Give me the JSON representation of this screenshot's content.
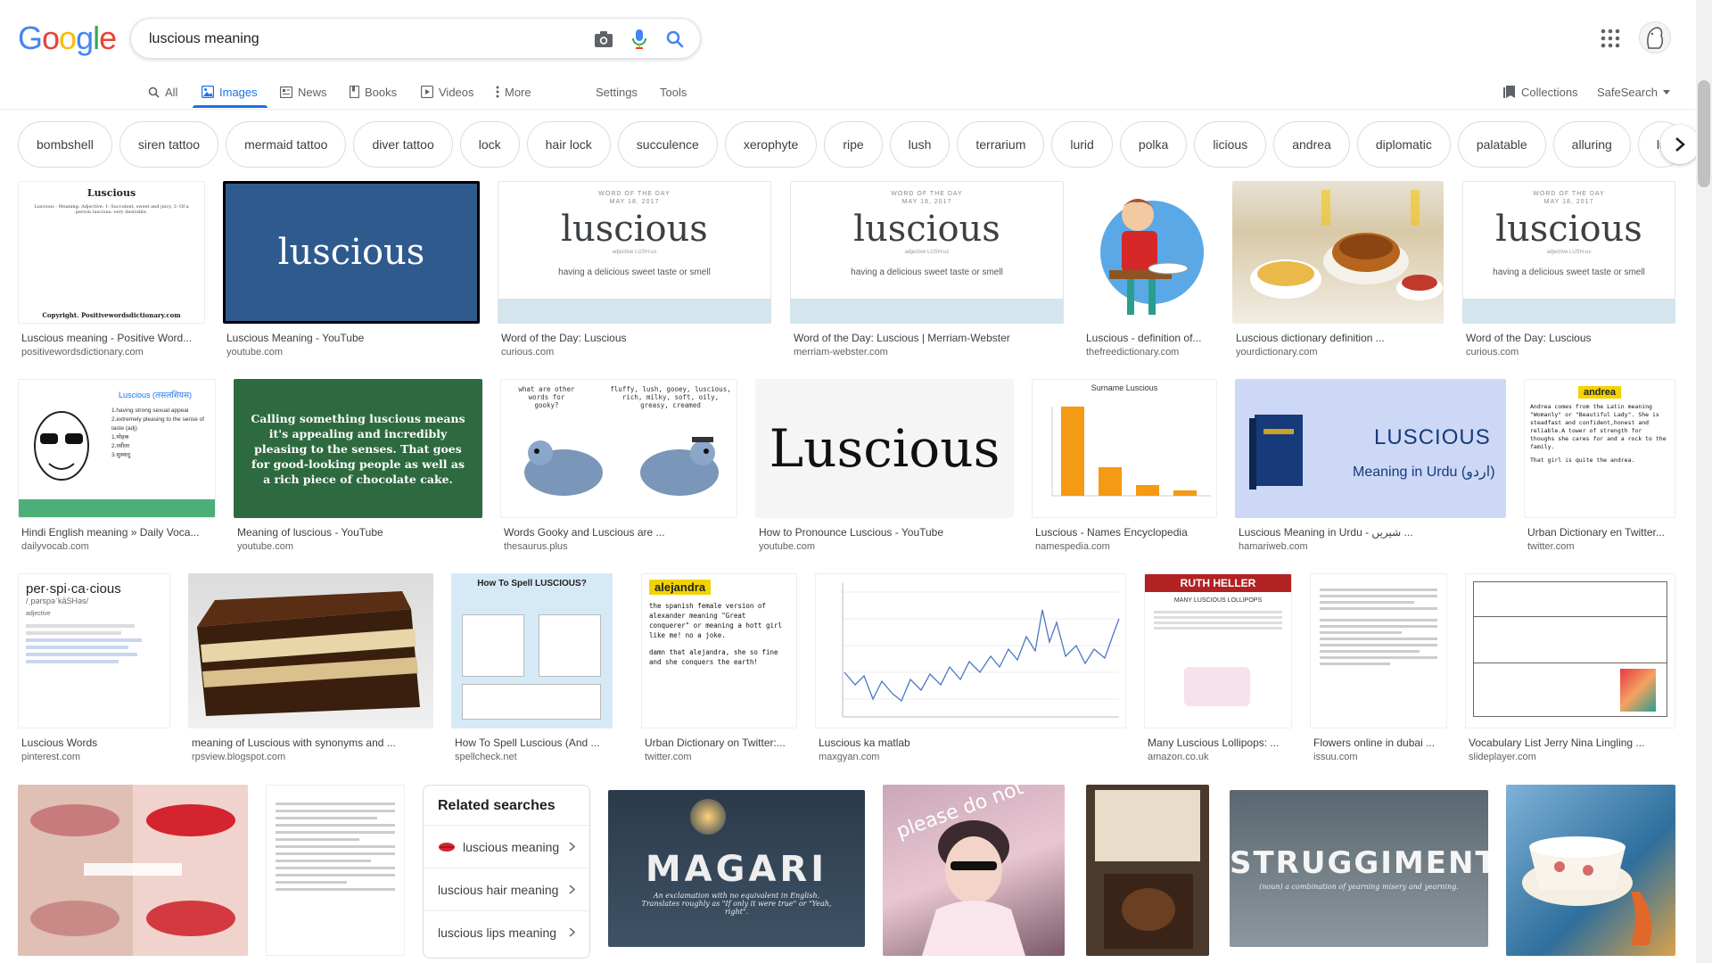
{
  "search": {
    "query": "luscious meaning"
  },
  "logo": {
    "letters": [
      "G",
      "o",
      "o",
      "g",
      "l",
      "e"
    ],
    "colors": [
      "#4285F4",
      "#EA4335",
      "#FBBC05",
      "#4285F4",
      "#34A853",
      "#EA4335"
    ]
  },
  "tabs": {
    "all": "All",
    "images": "Images",
    "news": "News",
    "books": "Books",
    "videos": "Videos",
    "more": "More",
    "settings": "Settings",
    "tools": "Tools",
    "collections": "Collections",
    "safesearch": "SafeSearch"
  },
  "chips": [
    "bombshell",
    "siren tattoo",
    "mermaid tattoo",
    "diver tattoo",
    "lock",
    "hair lock",
    "succulence",
    "xerophyte",
    "ripe",
    "lush",
    "terrarium",
    "lurid",
    "polka",
    "licious",
    "andrea",
    "diplomatic",
    "palatable",
    "alluring",
    "lu"
  ],
  "results": [
    {
      "title": "Luscious meaning - Positive Word...",
      "source": "positivewordsdictionary.com",
      "thumb_title": "Luscious",
      "thumb_text": "Luscious - Meaning: Adjective: 1- Succulent, sweet and juicy. 2- Of a person luscious: very desirable.",
      "thumb_footer": "Copyright. Positivewordsdictionary.com"
    },
    {
      "title": "Luscious Meaning - YouTube",
      "source": "youtube.com",
      "thumb_word": "luscious"
    },
    {
      "title": "Word of the Day: Luscious",
      "source": "curious.com",
      "hdr": "WORD OF THE DAY",
      "date": "MAY 18, 2017",
      "word": "luscious",
      "pron": "adjective LUSH-us",
      "def": "having a delicious sweet taste or smell"
    },
    {
      "title": "Word of the Day: Luscious | Merriam-Webster",
      "source": "merriam-webster.com",
      "hdr": "WORD OF THE DAY",
      "date": "MAY 18, 2017",
      "word": "luscious",
      "pron": "adjective LUSH-us",
      "def": "having a delicious sweet taste or smell"
    },
    {
      "title": "Luscious - definition of...",
      "source": "thefreedictionary.com"
    },
    {
      "title": "Luscious dictionary definition ...",
      "source": "yourdictionary.com"
    },
    {
      "title": "Word of the Day: Luscious",
      "source": "curious.com",
      "hdr": "WORD OF THE DAY",
      "date": "MAY 18, 2017",
      "word": "luscious",
      "pron": "adjective LUSH-us",
      "def": "having a delicious sweet taste or smell"
    },
    {
      "title": "Hindi English meaning » Daily Voca...",
      "source": "dailyvocab.com",
      "thumb_word": "Luscious (लसलशियस)",
      "thumb_lines": [
        "1.having strong sexual appeal",
        "2.extremely pleasing to the sense of taste (adj)",
        "1.मोहक",
        "2.रसीला",
        "3.सुस्वादु"
      ]
    },
    {
      "title": "Meaning of luscious - YouTube",
      "source": "youtube.com",
      "thumb_text": "Calling something luscious means it's appealing and incredibly pleasing to the senses. That goes for good-looking people as well as a rich piece of chocolate cake."
    },
    {
      "title": "Words Gooky and Luscious are ...",
      "source": "thesaurus.plus",
      "thumb_left": "what are other words for gooky?",
      "thumb_right": "fluffy, lush, gooey, luscious, rich, milky, soft, oily, greasy, creamed"
    },
    {
      "title": "How to Pronounce Luscious - YouTube",
      "source": "youtube.com",
      "thumb_word": "Luscious"
    },
    {
      "title": "Luscious - Names Encyclopedia",
      "source": "namespedia.com",
      "thumb_title": "Surname Luscious"
    },
    {
      "title": "Luscious Meaning in Urdu - شیریں ...",
      "source": "hamariweb.com",
      "thumb_word": "LUSCIOUS",
      "thumb_sub": "Meaning in Urdu (اردو)"
    },
    {
      "title": "Urban Dictionary en Twitter...",
      "source": "twitter.com",
      "thumb_name": "andrea",
      "thumb_text": "Andrea comes from the Latin meaning \"Womanly\" or \"Beautiful Lady\". She is steadfast and confident,honest and reliable.A tower of strength for thoughs she cares for and a rock to the family.",
      "thumb_ex": "That girl is quite the andrea."
    },
    {
      "title": "Luscious Words",
      "source": "pinterest.com",
      "thumb_word": "per·spi·ca·cious",
      "thumb_pron": "/ˌpərspəˈkāSHəs/",
      "thumb_pos": "adjective"
    },
    {
      "title": "meaning of Luscious with synonyms and ...",
      "source": "rpsview.blogspot.com"
    },
    {
      "title": "How To Spell Luscious (And ...",
      "source": "spellcheck.net",
      "thumb_title": "How To Spell LUSCIOUS?"
    },
    {
      "title": "Urban Dictionary on Twitter:...",
      "source": "twitter.com",
      "thumb_name": "alejandra",
      "thumb_text": "the spanish female version of alexander meaning \"Great conquerer\" or meaning a hott girl like me! no a joke.",
      "thumb_ex": "damn that alejandra, she so fine and she conquers the earth!"
    },
    {
      "title": "Luscious ka matlab",
      "source": "maxgyan.com"
    },
    {
      "title": "Many Luscious Lollipops: ...",
      "source": "amazon.co.uk",
      "thumb_title": "RUTH HELLER",
      "thumb_sub": "MANY LUSCIOUS LOLLIPOPS"
    },
    {
      "title": "Flowers online in dubai ...",
      "source": "issuu.com"
    },
    {
      "title": "Vocabulary List Jerry Nina Lingling ...",
      "source": "slideplayer.com"
    }
  ],
  "row4": {
    "magari": "MAGARI",
    "magari_sub": "An exclamation with no equivalent in English. Translates roughly as \"If only it were true\" or \"Yeah, right\".",
    "please": "please do not",
    "struggimento": "STRUGGIMENTO",
    "struggimento_sub": "(noun) a combination of yearning misery and yearning."
  },
  "related": {
    "heading": "Related searches",
    "items": [
      "luscious meaning",
      "luscious hair meaning",
      "luscious lips meaning"
    ]
  }
}
